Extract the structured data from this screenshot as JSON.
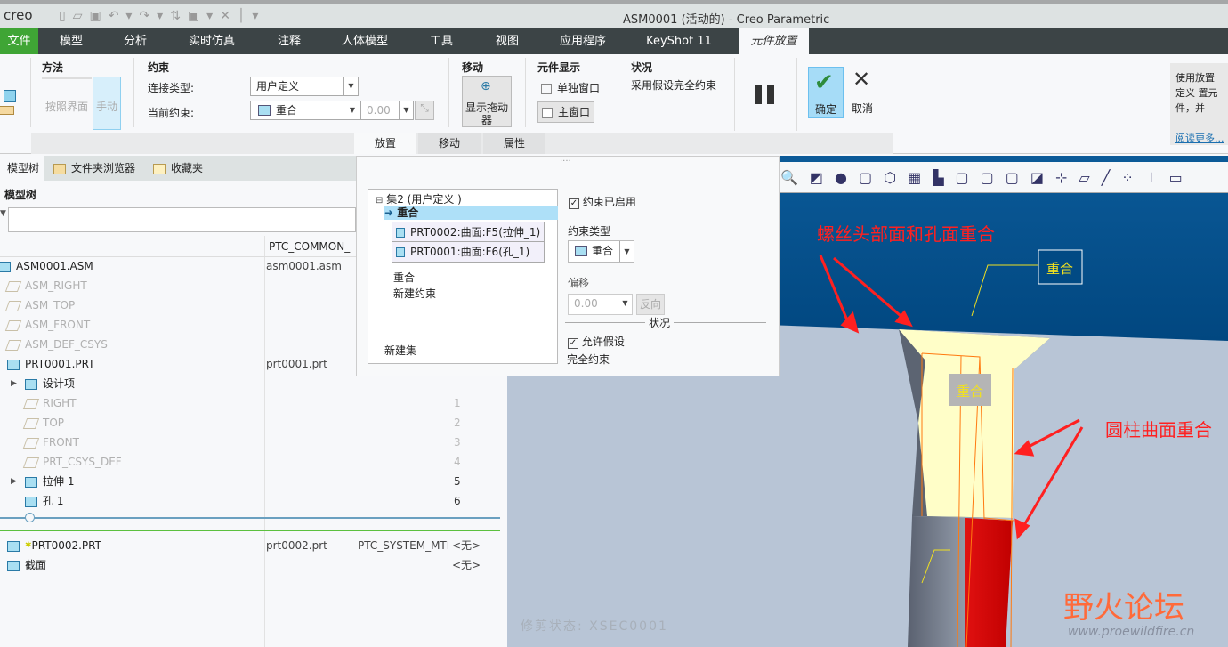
{
  "app": {
    "logo": "creo",
    "title": "ASM0001 (活动的) - Creo Parametric"
  },
  "menu": [
    "文件",
    "模型",
    "分析",
    "实时仿真",
    "注释",
    "人体模型",
    "工具",
    "视图",
    "应用程序",
    "KeyShot 11",
    "元件放置"
  ],
  "ribbon": {
    "method": {
      "title": "方法",
      "interface": "按照界面",
      "manual": "手动"
    },
    "constraint": {
      "title": "约束",
      "conn_type_label": "连接类型:",
      "conn_type_value": "用户定义",
      "current_label": "当前约束:",
      "current_value": "重合",
      "offset_value": "0.00"
    },
    "move": {
      "title": "移动",
      "dragger": "显示拖动器"
    },
    "display": {
      "title": "元件显示",
      "separate": "单独窗口",
      "main": "主窗口"
    },
    "status": {
      "title": "状况",
      "text": "采用假设完全约束"
    },
    "ok": "确定",
    "cancel": "取消",
    "help": {
      "text": "使用放置定义 置元件，并",
      "link": "阅读更多..."
    },
    "subtabs": [
      "放置",
      "移动",
      "属性"
    ]
  },
  "panel_tabs": [
    "模型树",
    "文件夹浏览器",
    "收藏夹"
  ],
  "model_tree": {
    "title": "模型树",
    "col2": "PTC_COMMON_",
    "rows": [
      {
        "name": "ASM0001.ASM",
        "file": "asm0001.asm",
        "num": "",
        "extra": "",
        "dim": false,
        "indent": 0,
        "icon": "assembly-icon"
      },
      {
        "name": "ASM_RIGHT",
        "file": "",
        "num": "",
        "extra": "",
        "dim": true,
        "indent": 1,
        "icon": "datum-plane-icon"
      },
      {
        "name": "ASM_TOP",
        "file": "",
        "num": "",
        "extra": "",
        "dim": true,
        "indent": 1,
        "icon": "datum-plane-icon"
      },
      {
        "name": "ASM_FRONT",
        "file": "",
        "num": "",
        "extra": "",
        "dim": true,
        "indent": 1,
        "icon": "datum-plane-icon"
      },
      {
        "name": "ASM_DEF_CSYS",
        "file": "",
        "num": "",
        "extra": "",
        "dim": true,
        "indent": 1,
        "icon": "csys-icon"
      },
      {
        "name": "PRT0001.PRT",
        "file": "prt0001.prt",
        "num": "",
        "extra": "",
        "dim": false,
        "indent": 1,
        "icon": "part-icon"
      },
      {
        "name": "设计项",
        "file": "",
        "num": "",
        "extra": "",
        "dim": false,
        "indent": 2,
        "icon": "design-items-icon",
        "expand": true
      },
      {
        "name": "RIGHT",
        "file": "",
        "num": "1",
        "extra": "",
        "dim": true,
        "indent": 2,
        "icon": "datum-plane-icon"
      },
      {
        "name": "TOP",
        "file": "",
        "num": "2",
        "extra": "",
        "dim": true,
        "indent": 2,
        "icon": "datum-plane-icon"
      },
      {
        "name": "FRONT",
        "file": "",
        "num": "3",
        "extra": "",
        "dim": true,
        "indent": 2,
        "icon": "datum-plane-icon"
      },
      {
        "name": "PRT_CSYS_DEF",
        "file": "",
        "num": "4",
        "extra": "",
        "dim": true,
        "indent": 2,
        "icon": "csys-icon"
      },
      {
        "name": "拉伸 1",
        "file": "",
        "num": "5",
        "extra": "",
        "dim": false,
        "indent": 2,
        "icon": "extrude-icon",
        "expand": true
      },
      {
        "name": "孔 1",
        "file": "",
        "num": "6",
        "extra": "",
        "dim": false,
        "indent": 2,
        "icon": "hole-icon"
      }
    ],
    "rows2": [
      {
        "name": "PRT0002.PRT",
        "file": "prt0002.prt",
        "mtr": "PTC_SYSTEM_MTF",
        "extra": "<无>"
      },
      {
        "name": "截面",
        "file": "",
        "mtr": "",
        "extra": "<无>"
      }
    ]
  },
  "dialog": {
    "set": "集2 (用户定义 )",
    "selected": "重合",
    "refs": [
      "PRT0002:曲面:F5(拉伸_1)",
      "PRT0001:曲面:F6(孔_1)"
    ],
    "items": [
      "重合",
      "新建约束"
    ],
    "new_set": "新建集",
    "enabled": "约束已启用",
    "type_label": "约束类型",
    "type_value": "重合",
    "offset_label": "偏移",
    "offset_value": "0.00",
    "flip": "反向",
    "status_label": "状况",
    "allow": "允许假设",
    "full": "完全约束"
  },
  "viewport": {
    "annot1": "螺丝头部面和孔面重合",
    "annot2": "圆柱曲面重合",
    "tag1": "重合",
    "tag2": "重合",
    "xsec": "修剪状态: XSEC0001",
    "watermark": "野火论坛",
    "watermark_url": "www.proewildfire.cn"
  }
}
